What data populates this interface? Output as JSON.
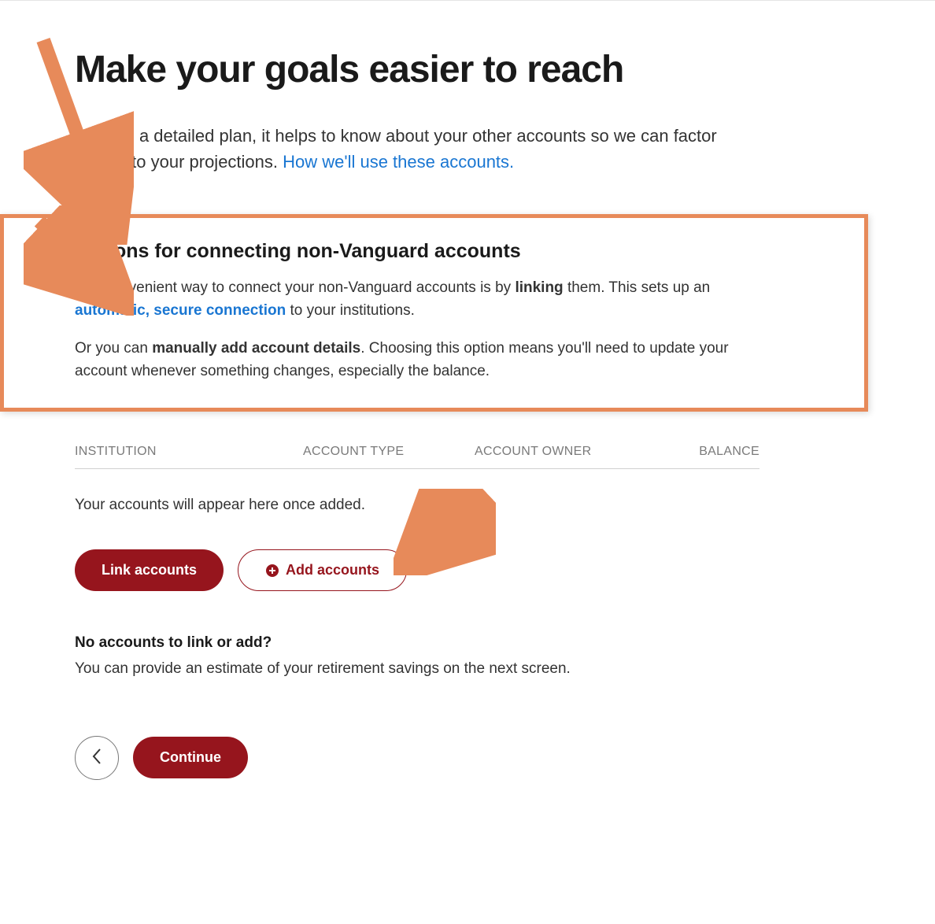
{
  "page": {
    "title": "Make your goals easier to reach",
    "intro_prefix": "To build a detailed plan, it helps to know about your other accounts so we can factor them into your projections. ",
    "intro_link": "How we'll use these accounts."
  },
  "callout": {
    "heading": "Options for connecting non-Vanguard accounts",
    "p1_prefix": "The convenient way to connect your non-Vanguard accounts is by ",
    "p1_bold": "linking",
    "p1_mid": " them. This sets up an ",
    "p1_link": "automatic, secure connection",
    "p1_suffix": " to your institutions.",
    "p2_prefix": "Or you can ",
    "p2_bold": "manually add account details",
    "p2_suffix": ". Choosing this option means you'll need to update your account whenever something changes, especially the balance."
  },
  "table": {
    "headers": {
      "institution": "INSTITUTION",
      "account_type": "ACCOUNT TYPE",
      "account_owner": "ACCOUNT OWNER",
      "balance": "BALANCE"
    },
    "empty_label": "Your accounts will appear here once added."
  },
  "buttons": {
    "link_accounts": "Link accounts",
    "add_accounts": "Add accounts",
    "continue": "Continue"
  },
  "footer": {
    "subheading": "No accounts to link or add?",
    "subtext": "You can provide an estimate of your retirement savings on the next screen."
  }
}
